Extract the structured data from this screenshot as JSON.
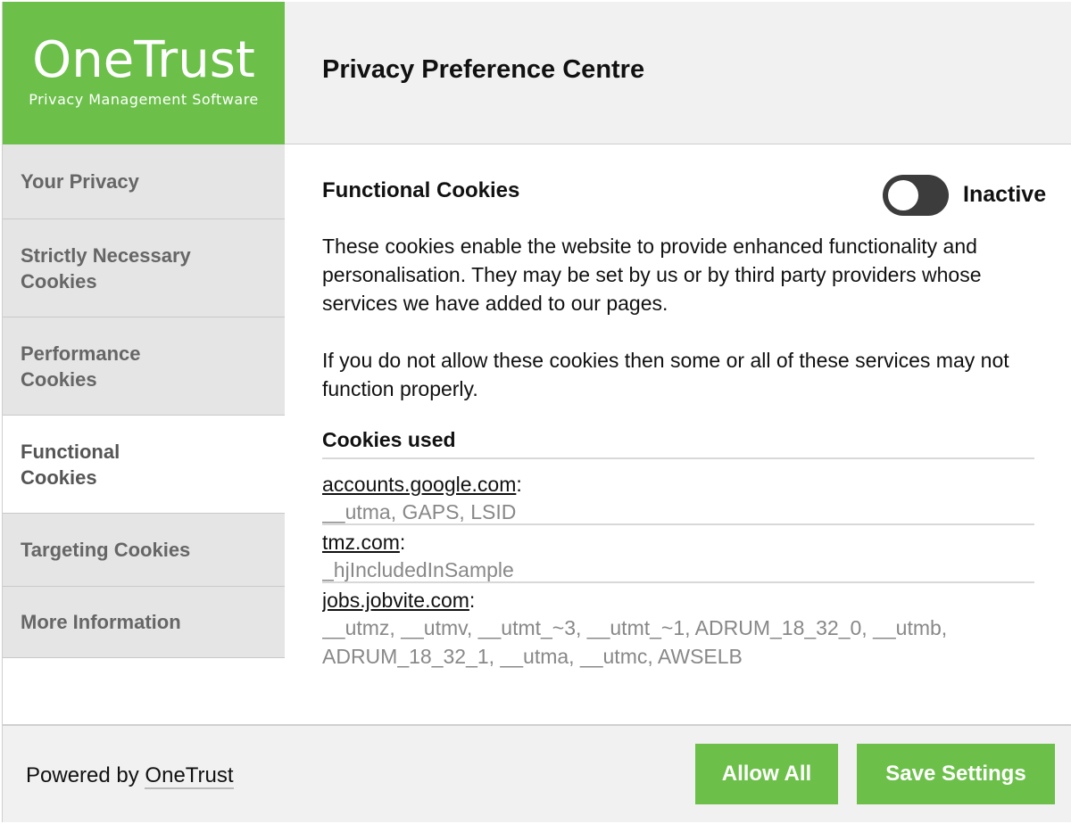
{
  "brand": {
    "name": "OneTrust",
    "tagline": "Privacy Management Software",
    "color": "#6cc04a"
  },
  "header": {
    "title": "Privacy Preference Centre"
  },
  "sidebar": {
    "items": [
      {
        "label": "Your Privacy",
        "active": false
      },
      {
        "label": "Strictly Necessary Cookies",
        "active": false
      },
      {
        "label": "Performance Cookies",
        "active": false
      },
      {
        "label": "Functional Cookies",
        "active": true
      },
      {
        "label": "Targeting Cookies",
        "active": false
      },
      {
        "label": "More Information",
        "active": false
      }
    ]
  },
  "section": {
    "title": "Functional Cookies",
    "toggle_state": "Inactive",
    "description": [
      "These cookies enable the website to provide enhanced functionality and personalisation. They may be set by us or by third party providers whose services we have added to our pages.",
      "If you do not allow these cookies then some or all of these services may not function properly."
    ],
    "cookies_heading": "Cookies used",
    "cookies": [
      {
        "host": "accounts.google.com",
        "names": "__utma, GAPS, LSID"
      },
      {
        "host": "tmz.com",
        "names": "_hjIncludedInSample"
      },
      {
        "host": "jobs.jobvite.com",
        "names": "__utmz, __utmv, __utmt_~3, __utmt_~1, ADRUM_18_32_0, __utmb, ADRUM_18_32_1, __utma, __utmc, AWSELB"
      }
    ]
  },
  "footer": {
    "powered_prefix": "Powered by",
    "powered_brand": "OneTrust",
    "allow_all": "Allow All",
    "save_settings": "Save Settings"
  }
}
